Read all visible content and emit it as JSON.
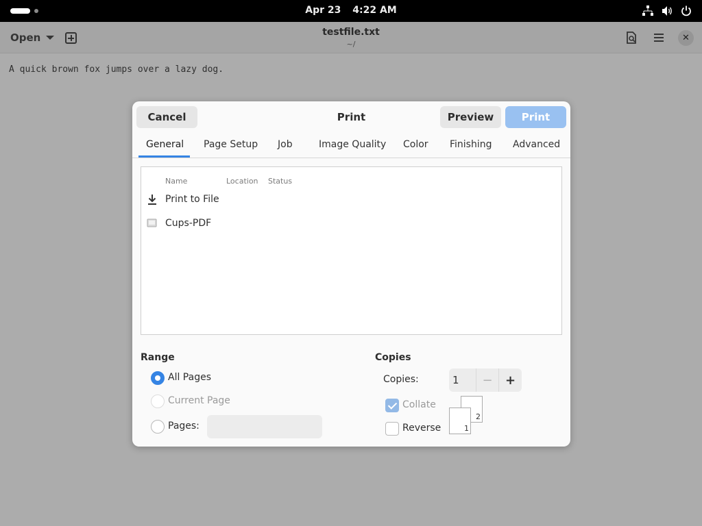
{
  "topbar": {
    "date": "Apr 23",
    "time": "4:22 AM",
    "icons": [
      "network-icon",
      "volume-icon",
      "power-icon"
    ]
  },
  "editor": {
    "open_label": "Open",
    "title": "testfile.txt",
    "subtitle": "~/",
    "content": "A quick brown fox jumps over a lazy dog."
  },
  "dialog": {
    "title": "Print",
    "cancel_label": "Cancel",
    "preview_label": "Preview",
    "print_label": "Print",
    "tabs": [
      {
        "label": "General",
        "active": true
      },
      {
        "label": "Page Setup"
      },
      {
        "label": "Job"
      },
      {
        "label": "Image Quality"
      },
      {
        "label": "Color"
      },
      {
        "label": "Finishing"
      },
      {
        "label": "Advanced"
      }
    ],
    "printer_columns": [
      "Name",
      "Location",
      "Status"
    ],
    "printers": [
      {
        "name": "Print to File",
        "icon": "download-icon"
      },
      {
        "name": "Cups-PDF",
        "icon": "printer-icon"
      }
    ],
    "range": {
      "title": "Range",
      "all_pages": "All Pages",
      "current_page": "Current Page",
      "pages": "Pages:",
      "pages_value": "",
      "selected": "All Pages"
    },
    "copies": {
      "title": "Copies",
      "label": "Copies:",
      "value": "1",
      "collate": "Collate",
      "collate_checked": true,
      "reverse": "Reverse",
      "reverse_checked": false,
      "sheet_back": "2",
      "sheet_front": "1"
    }
  },
  "colors": {
    "accent": "#3584e4",
    "print_button": "#99c1f1"
  }
}
